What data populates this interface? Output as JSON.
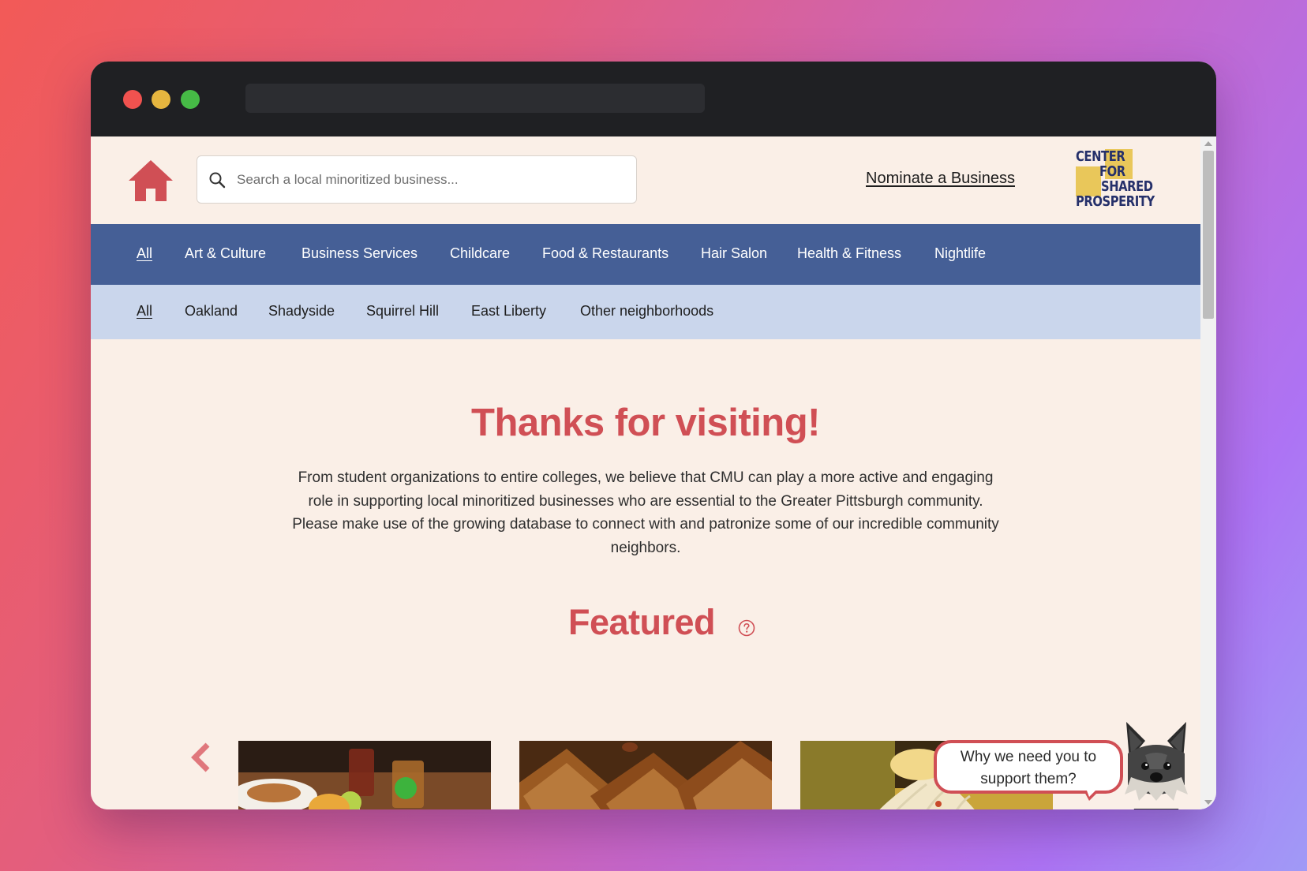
{
  "header": {
    "search_placeholder": "Search a local minoritized business...",
    "nominate_label": "Nominate a Business",
    "logo_lines": [
      "CENTER",
      "FOR",
      "SHARED",
      "PROSPERITY"
    ]
  },
  "categories": [
    "All",
    "Art & Culture",
    "Business Services",
    "Childcare",
    "Food & Restaurants",
    "Hair Salon",
    "Health & Fitness",
    "Nightlife"
  ],
  "neighborhoods": [
    "All",
    "Oakland",
    "Shadyside",
    "Squirrel Hill",
    "East Liberty",
    "Other neighborhoods"
  ],
  "hero": {
    "title": "Thanks for visiting!",
    "description": "From student organizations to entire colleges, we believe that CMU can play a more active and engaging role in supporting local minoritized businesses who are essential to the Greater Pittsburgh community. Please make use of the growing database to connect with and patronize some of our incredible community neighbors."
  },
  "featured": {
    "title": "Featured"
  },
  "mascot": {
    "speech": "Why we need you to support them?"
  },
  "colors": {
    "accent": "#d04f55",
    "nav_primary": "#455f96",
    "nav_secondary": "#cad6ec",
    "page_bg": "#faefe7",
    "logo_gold": "#e9c75a",
    "logo_navy": "#25306a"
  }
}
